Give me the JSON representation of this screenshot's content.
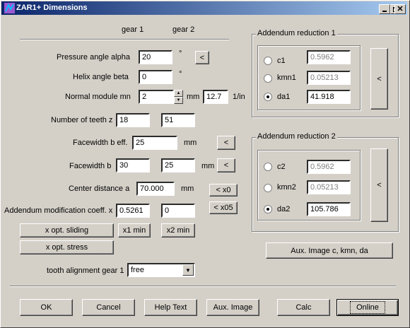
{
  "window": {
    "title": "ZAR1+ Dimensions",
    "minimize_icon": "minimize-icon",
    "maximize_icon": "maximize-icon",
    "close_icon": "close-icon"
  },
  "columns": {
    "gear1": "gear 1",
    "gear2": "gear 2"
  },
  "fields": {
    "pressure_angle": {
      "label": "Pressure angle alpha",
      "value": "20",
      "unit": "°",
      "button": "<"
    },
    "helix_angle": {
      "label": "Helix angle beta",
      "value": "0",
      "unit": "°"
    },
    "normal_module": {
      "label": "Normal module mn",
      "value": "2",
      "unit": "mm",
      "value_in": "12.7",
      "unit_in": "1/in"
    },
    "teeth": {
      "label": "Number of teeth z",
      "gear1": "18",
      "gear2": "51"
    },
    "facewidth_eff": {
      "label": "Facewidth b eff.",
      "value": "25",
      "unit": "mm",
      "button": "<"
    },
    "facewidth": {
      "label": "Facewidth b",
      "gear1": "30",
      "gear2": "25",
      "unit": "mm",
      "button": "<"
    },
    "center_distance": {
      "label": "Center distance a",
      "value": "70.000",
      "unit": "mm",
      "button_x0": "< x0",
      "button_x05": "< x05"
    },
    "addendum_mod": {
      "label": "Addendum modification coeff. x",
      "gear1": "0.5261",
      "gear2": "0"
    }
  },
  "buttons": {
    "x_opt_sliding": "x opt. sliding",
    "x1_min": "x1 min",
    "x2_min": "x2 min",
    "x_opt_stress": "x opt. stress",
    "aux_image_ckd": "Aux. Image c, kmn, da",
    "ok": "OK",
    "cancel": "Cancel",
    "help_text": "Help Text",
    "aux_image": "Aux. Image",
    "calc": "Calc",
    "online": "Online"
  },
  "tooth_alignment": {
    "label": "tooth alignment gear 1",
    "selected": "free"
  },
  "addendum_reduction_1": {
    "title": "Addendum reduction 1",
    "options": [
      {
        "label": "c1",
        "value": "0.5962",
        "selected": false,
        "disabled": true
      },
      {
        "label": "kmn1",
        "value": "0.05213",
        "selected": false,
        "disabled": true
      },
      {
        "label": "da1",
        "value": "41.918",
        "selected": true,
        "disabled": false
      }
    ],
    "button": "<"
  },
  "addendum_reduction_2": {
    "title": "Addendum reduction 2",
    "options": [
      {
        "label": "c2",
        "value": "0.5962",
        "selected": false,
        "disabled": true
      },
      {
        "label": "kmn2",
        "value": "0.05213",
        "selected": false,
        "disabled": true
      },
      {
        "label": "da2",
        "value": "105.786",
        "selected": true,
        "disabled": false
      }
    ],
    "button": "<"
  }
}
